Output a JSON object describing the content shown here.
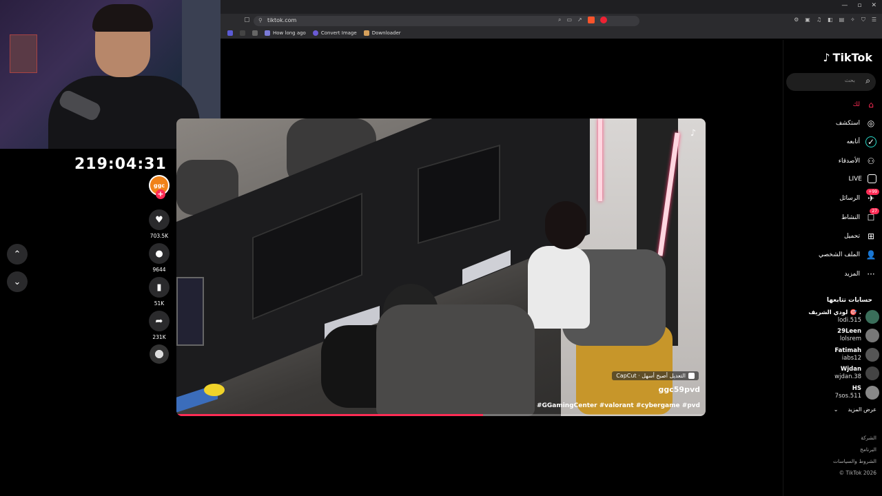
{
  "browser": {
    "url": "tiktok.com",
    "bookmarks": [
      "How long ago",
      "Convert Image",
      "Downloader"
    ],
    "window_controls": [
      "—",
      "▫",
      "✕"
    ]
  },
  "timer": "219:04:31",
  "video": {
    "capcut_label": "CapCut · التعديل أصبح أسهل",
    "username": "ggc59pvd",
    "caption": "#GGamingCenter #valorant #cybergame #pvd",
    "progress_percent": 58
  },
  "actions": {
    "creator_badge": "ggc",
    "likes": "703.5K",
    "comments": "9644",
    "saves": "51K",
    "shares": "231K"
  },
  "sidebar": {
    "logo": "TikTok",
    "search_placeholder": "بحث",
    "nav": [
      {
        "label": "لك",
        "icon": "home-icon",
        "glyph": "⌂"
      },
      {
        "label": "استكشف",
        "icon": "compass-icon",
        "glyph": "◎"
      },
      {
        "label": "أتابعه",
        "icon": "following-icon",
        "glyph": "✓"
      },
      {
        "label": "الأصدقاء",
        "icon": "friends-icon",
        "glyph": "⚇"
      },
      {
        "label": "LIVE",
        "icon": "live-icon",
        "glyph": "LIVE"
      },
      {
        "label": "الرسائل",
        "icon": "messages-icon",
        "glyph": "✈",
        "badge": "+99"
      },
      {
        "label": "النشاط",
        "icon": "activity-icon",
        "glyph": "☐",
        "badge": "27"
      },
      {
        "label": "تحميل",
        "icon": "upload-icon",
        "glyph": "⊞"
      },
      {
        "label": "الملف الشخصي",
        "icon": "profile-icon",
        "glyph": "👤"
      },
      {
        "label": "المزيد",
        "icon": "more-icon",
        "glyph": "···"
      }
    ],
    "following_title": "حسابات تتابعها",
    "accounts": [
      {
        "name": "لودي الشريف 🎯 .",
        "handle": "lodi.515",
        "color": "#3a6e5a"
      },
      {
        "name": "29Leen",
        "handle": "lolsrem",
        "color": "#777"
      },
      {
        "name": "Fatimah",
        "handle": "iabs12",
        "color": "#555"
      },
      {
        "name": "Wjdan",
        "handle": "wjdan.38",
        "color": "#444"
      },
      {
        "name": "HS",
        "handle": "7sos.511",
        "color": "#888"
      }
    ],
    "see_more": "عرض المزيد",
    "footer": [
      "الشركة",
      "البرنامج",
      "الشروط والسياسات",
      "© TikTok 2026"
    ]
  },
  "colors": {
    "accent": "#fe2c55",
    "sidebar_bg": "#000000",
    "chrome_bg": "#2b2b2e"
  }
}
